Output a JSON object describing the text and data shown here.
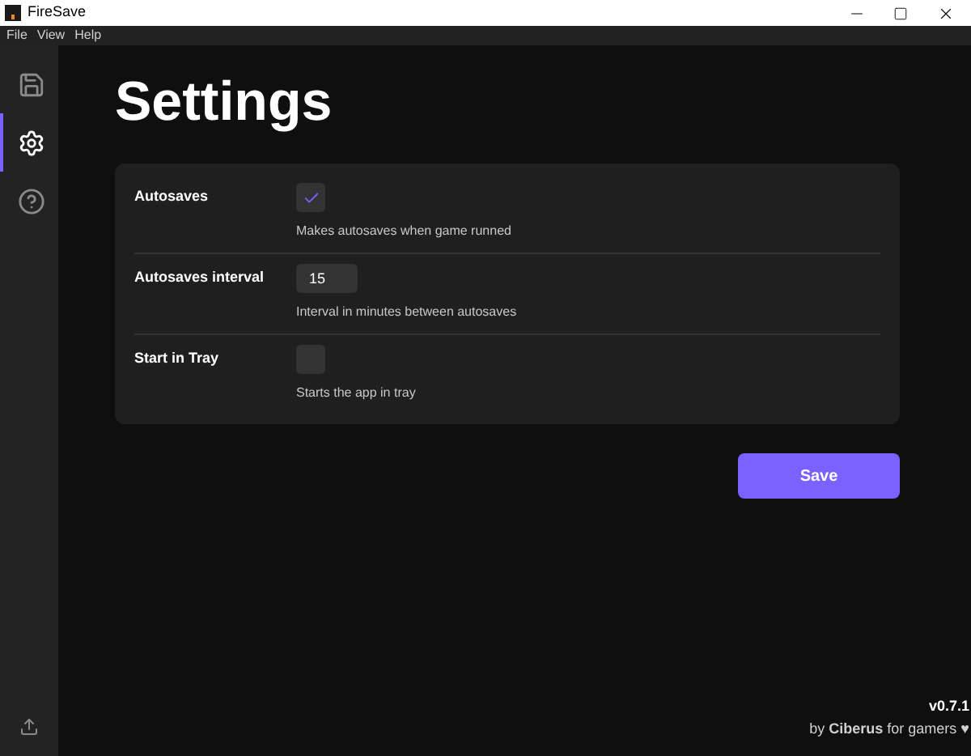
{
  "window": {
    "title": "FireSave"
  },
  "menu": [
    "File",
    "View",
    "Help"
  ],
  "sidebar": {
    "items": [
      {
        "kind": "save",
        "selected": false
      },
      {
        "kind": "settings",
        "selected": true
      },
      {
        "kind": "help",
        "selected": false
      }
    ]
  },
  "page": {
    "title": "Settings"
  },
  "settings": [
    {
      "kind": "checkbox",
      "label": "Autosaves",
      "checked": true,
      "description": "Makes autosaves when game runned"
    },
    {
      "kind": "number",
      "label": "Autosaves interval",
      "value": "15",
      "description": "Interval in minutes between autosaves"
    },
    {
      "kind": "checkbox",
      "label": "Start in Tray",
      "checked": false,
      "description": "Starts the app in tray"
    }
  ],
  "save_button": "Save",
  "footer": {
    "version": "v0.7.1",
    "credit": "by **Ciberus** for gamers ♥"
  }
}
